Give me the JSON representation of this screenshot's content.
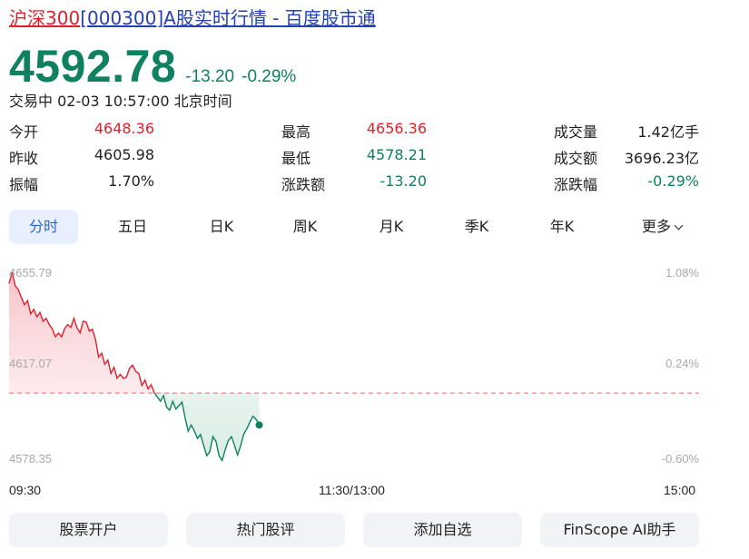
{
  "page_title": {
    "index_name": "沪深300",
    "code": "[000300]",
    "rest": "A股实时行情 - 百度股市通"
  },
  "quote": {
    "price": "4592.78",
    "change": "-13.20",
    "change_pct": "-0.29%",
    "status": "交易中 02-03 10:57:00 北京时间"
  },
  "stats": {
    "open": {
      "label": "今开",
      "value": "4648.36"
    },
    "prev_close": {
      "label": "昨收",
      "value": "4605.98"
    },
    "amplitude": {
      "label": "振幅",
      "value": "1.70%"
    },
    "high": {
      "label": "最高",
      "value": "4656.36"
    },
    "low": {
      "label": "最低",
      "value": "4578.21"
    },
    "change_amount": {
      "label": "涨跌额",
      "value": "-13.20"
    },
    "volume": {
      "label": "成交量",
      "value": "1.42亿手"
    },
    "turnover": {
      "label": "成交额",
      "value": "3696.23亿"
    },
    "change_rate": {
      "label": "涨跌幅",
      "value": "-0.29%"
    }
  },
  "tabs": [
    "分时",
    "五日",
    "日K",
    "周K",
    "月K",
    "季K",
    "年K",
    "更多"
  ],
  "active_tab": "分时",
  "chart": {
    "y_labels_left": [
      "4655.79",
      "4617.07",
      "4578.35"
    ],
    "y_labels_right": [
      "1.08%",
      "0.24%",
      "-0.60%"
    ],
    "time_labels": [
      "09:30",
      "11:30/13:00",
      "15:00"
    ]
  },
  "chart_data": {
    "type": "line",
    "yaxis_left": [
      4578.35,
      4655.79
    ],
    "yaxis_right_pct": [
      -0.6,
      1.08
    ],
    "prev_close": 4605.98,
    "session_minutes": 240,
    "elapsed_minutes": 87,
    "values": [
      4651.1,
      4655.8,
      4650.2,
      4648.6,
      4645.3,
      4642.4,
      4644.1,
      4638.6,
      4640.5,
      4637.4,
      4639.2,
      4635.6,
      4636.8,
      4634.2,
      4632.4,
      4629.2,
      4630.7,
      4629.2,
      4632.6,
      4634.2,
      4633.0,
      4636.8,
      4632.9,
      4630.8,
      4635.6,
      4635.2,
      4631.5,
      4632.3,
      4628.0,
      4620.8,
      4622.4,
      4617.9,
      4619.6,
      4614.1,
      4616.6,
      4612.1,
      4613.7,
      4612.1,
      4612.5,
      4616.1,
      4617.5,
      4614.9,
      4614.0,
      4609.1,
      4611.3,
      4607.7,
      4609.4,
      4606.1,
      4604.4,
      4602.6,
      4604.9,
      4600.2,
      4598.9,
      4602.6,
      4599.4,
      4600.8,
      4602.2,
      4595.7,
      4590.3,
      4592.8,
      4590.3,
      4587.3,
      4588.9,
      4584.4,
      4580.2,
      4581.8,
      4588.0,
      4586.1,
      4580.1,
      4578.2,
      4582.7,
      4586.4,
      4588.0,
      4584.4,
      4580.5,
      4584.3,
      4589.1,
      4591.3,
      4594.1,
      4596.4,
      4595.1,
      4592.8
    ]
  },
  "colors": {
    "up": "#e0202c",
    "down": "#0f8060",
    "prev_close_line": "#ee6677",
    "accent": "#2d63d8"
  },
  "actions": [
    "股票开户",
    "热门股评",
    "添加自选",
    "FinScope AI助手"
  ]
}
